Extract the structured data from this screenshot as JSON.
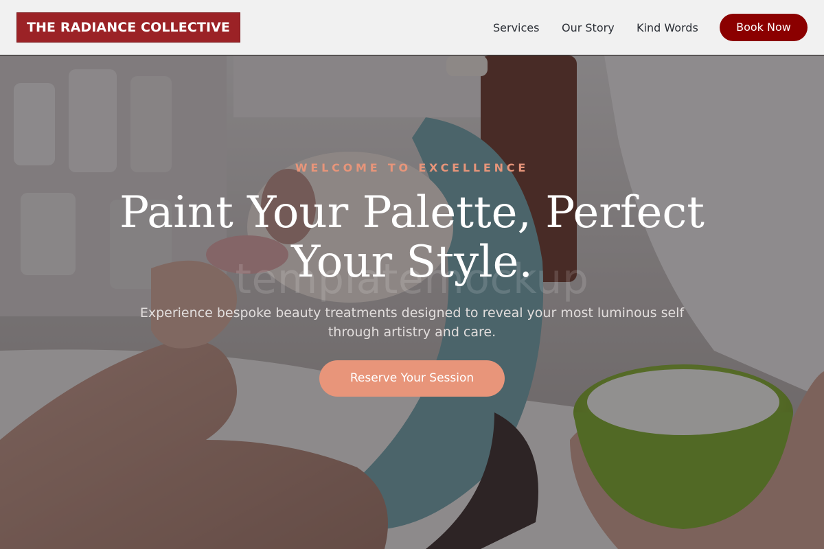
{
  "header": {
    "logo_text": "THE RADIANCE COLLECTIVE",
    "nav": {
      "services": "Services",
      "our_story": "Our Story",
      "kind_words": "Kind Words"
    },
    "book_button": "Book Now"
  },
  "hero": {
    "eyebrow": "WELCOME TO EXCELLENCE",
    "headline": "Paint Your Palette, Perfect Your Style.",
    "watermark": "templatemockup",
    "subtext": "Experience bespoke beauty treatments designed to reveal your most luminous self through artistry and care.",
    "cta_button": "Reserve Your Session",
    "background_image": "facial treatment spa photo"
  },
  "colors": {
    "brand": "#9b2226",
    "book_button": "#8b0000",
    "accent": "#e8957a",
    "header_bg": "#f1f1f1"
  }
}
